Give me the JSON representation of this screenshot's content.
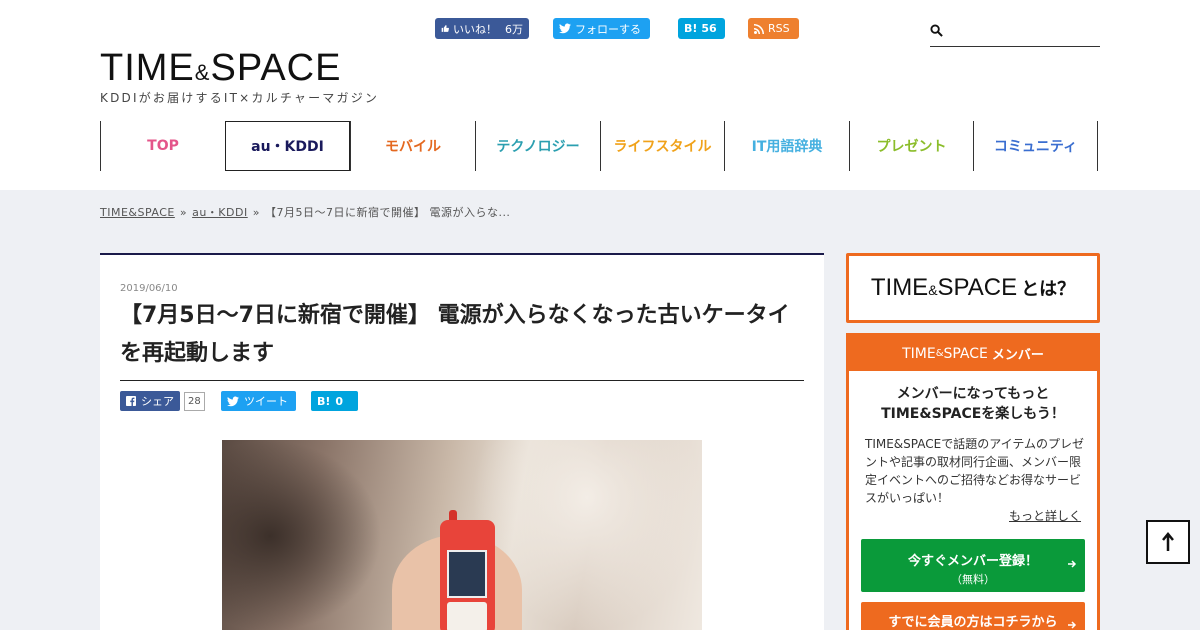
{
  "header": {
    "social": {
      "like_label": "いいね！",
      "like_count": "6万",
      "follow_label": "フォローする",
      "hatena_label": "B!",
      "hatena_count": "56",
      "rss_label": "RSS"
    },
    "search": {
      "placeholder": ""
    },
    "logo": {
      "left": "TIME",
      "amp": "&",
      "right": "SPACE"
    },
    "tagline": "KDDIがお届けするIT×カルチャーマガジン"
  },
  "nav": {
    "items": [
      {
        "label": "TOP",
        "color": "#e4558a"
      },
      {
        "label": "au・KDDI",
        "color": "#1a1a5c"
      },
      {
        "label": "モバイル",
        "color": "#e4681f"
      },
      {
        "label": "テクノロジー",
        "color": "#2b9fb0"
      },
      {
        "label": "ライフスタイル",
        "color": "#f0a21a"
      },
      {
        "label": "IT用語辞典",
        "color": "#45b0e0"
      },
      {
        "label": "プレゼント",
        "color": "#8bbd2a"
      },
      {
        "label": "コミュニティ",
        "color": "#3a6ed0"
      }
    ]
  },
  "breadcrumb": {
    "home": "TIME&SPACE",
    "category": "au・KDDI",
    "current": "【7月5日〜7日に新宿で開催】 電源が入らな...",
    "separator": "»"
  },
  "article": {
    "date": "2019/06/10",
    "title": "【7月5日〜7日に新宿で開催】 電源が入らなくなった古いケータイを再起動します",
    "share": {
      "facebook_label": "シェア",
      "facebook_count": "28",
      "twitter_label": "ツイート",
      "hatena_label": "B!",
      "hatena_count": "0"
    }
  },
  "sidebar": {
    "about": {
      "left": "TIME",
      "amp": "&",
      "right": "SPACE",
      "suffix": "とは？"
    },
    "member": {
      "head_left": "TIME",
      "head_amp": "&",
      "head_right": "SPACE",
      "head_suffix": "メンバー",
      "lead_line1": "メンバーになってもっと",
      "lead_line2": "TIME&SPACEを楽しもう！",
      "body": "TIME&SPACEで話題のアイテムのプレゼントや記事の取材同行企画、メンバー限定イベントへのご招待などお得なサービスがいっぱい！",
      "more_link": "もっと詳しく",
      "register_label": "今すぐメンバー登録！",
      "register_sub": "（無料）",
      "login_label": "すでに会員の方はコチラから"
    }
  },
  "colors": {
    "accent_orange": "#ee6a1f",
    "register_green": "#0a9a3a",
    "facebook_blue": "#3b5998",
    "twitter_blue": "#1da1f2",
    "hatena_blue": "#00a4de",
    "rss_orange": "#ee802f"
  }
}
